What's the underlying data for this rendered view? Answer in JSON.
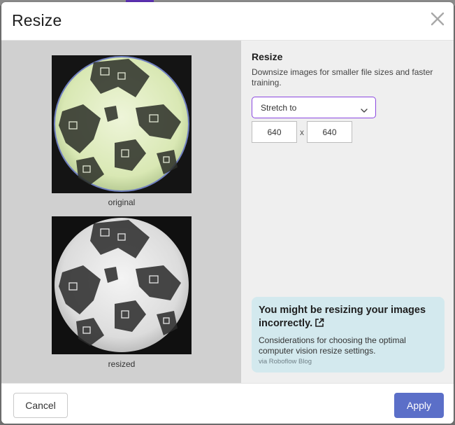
{
  "modal": {
    "title": "Resize",
    "close_icon": "close-icon"
  },
  "preview": {
    "original_caption": "original",
    "resized_caption": "resized"
  },
  "panel": {
    "heading": "Resize",
    "description": "Downsize images for smaller file sizes and faster training.",
    "mode_select": {
      "value": "Stretch to",
      "icon": "chevron-down-icon"
    },
    "width_value": "640",
    "separator": "x",
    "height_value": "640"
  },
  "tip": {
    "heading": "You might be resizing your images incorrectly.",
    "heading_icon": "external-link-icon",
    "body": "Considerations for choosing the optimal computer vision resize settings.",
    "source": "via Roboflow Blog"
  },
  "footer": {
    "cancel_label": "Cancel",
    "apply_label": "Apply"
  },
  "colors": {
    "accent_border": "#8a46e0",
    "apply_button": "#5b6fc8",
    "tip_background": "#d3e9ee"
  }
}
